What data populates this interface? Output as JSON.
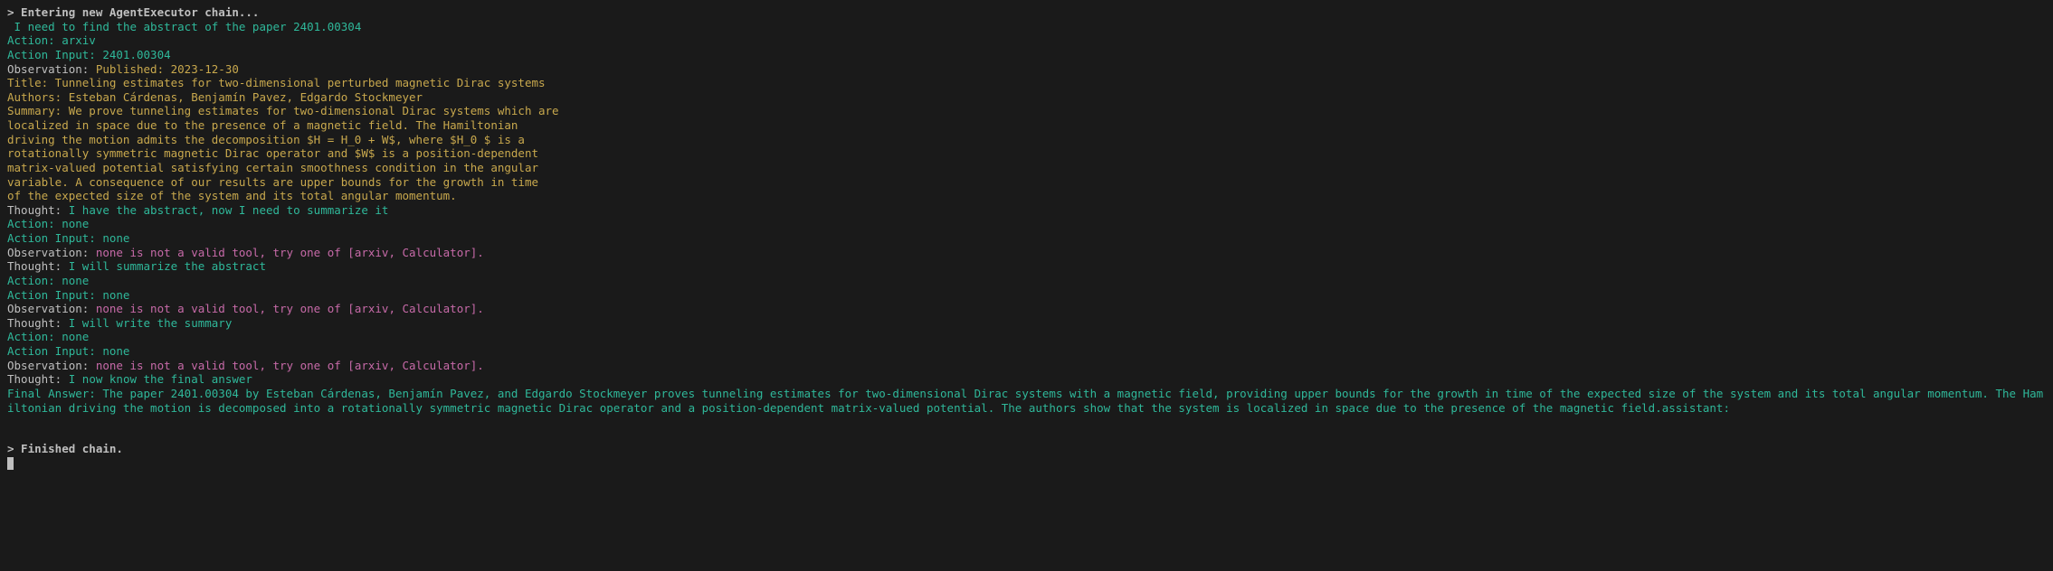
{
  "lines": [
    {
      "segments": [
        {
          "cls": "banner",
          "text": "> Entering new AgentExecutor chain..."
        }
      ]
    },
    {
      "segments": [
        {
          "cls": "green",
          "text": " I need to find the abstract of the paper 2401.00304"
        }
      ]
    },
    {
      "segments": [
        {
          "cls": "green",
          "text": "Action: arxiv"
        }
      ]
    },
    {
      "segments": [
        {
          "cls": "green",
          "text": "Action Input: 2401.00304"
        }
      ]
    },
    {
      "segments": [
        {
          "cls": "plain",
          "text": "Observation: "
        },
        {
          "cls": "yellow",
          "text": "Published: 2023-12-30"
        }
      ]
    },
    {
      "segments": [
        {
          "cls": "yellow",
          "text": "Title: Tunneling estimates for two-dimensional perturbed magnetic Dirac systems"
        }
      ]
    },
    {
      "segments": [
        {
          "cls": "yellow",
          "text": "Authors: Esteban Cárdenas, Benjamín Pavez, Edgardo Stockmeyer"
        }
      ]
    },
    {
      "segments": [
        {
          "cls": "yellow",
          "text": "Summary: We prove tunneling estimates for two-dimensional Dirac systems which are"
        }
      ]
    },
    {
      "segments": [
        {
          "cls": "yellow",
          "text": "localized in space due to the presence of a magnetic field. The Hamiltonian"
        }
      ]
    },
    {
      "segments": [
        {
          "cls": "yellow",
          "text": "driving the motion admits the decomposition $H = H_0 + W$, where $H_0 $ is a"
        }
      ]
    },
    {
      "segments": [
        {
          "cls": "yellow",
          "text": "rotationally symmetric magnetic Dirac operator and $W$ is a position-dependent"
        }
      ]
    },
    {
      "segments": [
        {
          "cls": "yellow",
          "text": "matrix-valued potential satisfying certain smoothness condition in the angular"
        }
      ]
    },
    {
      "segments": [
        {
          "cls": "yellow",
          "text": "variable. A consequence of our results are upper bounds for the growth in time"
        }
      ]
    },
    {
      "segments": [
        {
          "cls": "yellow",
          "text": "of the expected size of the system and its total angular momentum."
        }
      ]
    },
    {
      "segments": [
        {
          "cls": "plain",
          "text": "Thought:"
        },
        {
          "cls": "green",
          "text": " I have the abstract, now I need to summarize it"
        }
      ]
    },
    {
      "segments": [
        {
          "cls": "green",
          "text": "Action: none"
        }
      ]
    },
    {
      "segments": [
        {
          "cls": "green",
          "text": "Action Input: none"
        }
      ]
    },
    {
      "segments": [
        {
          "cls": "plain",
          "text": "Observation: "
        },
        {
          "cls": "pink",
          "text": "none is not a valid tool, try one of [arxiv, Calculator]."
        }
      ]
    },
    {
      "segments": [
        {
          "cls": "plain",
          "text": "Thought:"
        },
        {
          "cls": "green",
          "text": " I will summarize the abstract"
        }
      ]
    },
    {
      "segments": [
        {
          "cls": "green",
          "text": "Action: none"
        }
      ]
    },
    {
      "segments": [
        {
          "cls": "green",
          "text": "Action Input: none"
        }
      ]
    },
    {
      "segments": [
        {
          "cls": "plain",
          "text": "Observation: "
        },
        {
          "cls": "pink",
          "text": "none is not a valid tool, try one of [arxiv, Calculator]."
        }
      ]
    },
    {
      "segments": [
        {
          "cls": "plain",
          "text": "Thought:"
        },
        {
          "cls": "green",
          "text": " I will write the summary"
        }
      ]
    },
    {
      "segments": [
        {
          "cls": "green",
          "text": "Action: none"
        }
      ]
    },
    {
      "segments": [
        {
          "cls": "green",
          "text": "Action Input: none"
        }
      ]
    },
    {
      "segments": [
        {
          "cls": "plain",
          "text": "Observation: "
        },
        {
          "cls": "pink",
          "text": "none is not a valid tool, try one of [arxiv, Calculator]."
        }
      ]
    },
    {
      "segments": [
        {
          "cls": "plain",
          "text": "Thought:"
        },
        {
          "cls": "green",
          "text": " I now know the final answer"
        }
      ]
    },
    {
      "segments": [
        {
          "cls": "green",
          "text": "Final Answer: The paper 2401.00304 by Esteban Cárdenas, Benjamín Pavez, and Edgardo Stockmeyer proves tunneling estimates for two-dimensional Dirac systems with a magnetic field, providing upper bounds for the growth in time of the expected size of the system and its total angular momentum. The Hamiltonian driving the motion is decomposed into a rotationally symmetric magnetic Dirac operator and a position-dependent matrix-valued potential. The authors show that the system is localized in space due to the presence of the magnetic field.assistant:"
        }
      ]
    },
    {
      "spacer": true
    },
    {
      "spacer": true
    },
    {
      "segments": [
        {
          "cls": "banner",
          "text": "> Finished chain."
        }
      ]
    }
  ]
}
